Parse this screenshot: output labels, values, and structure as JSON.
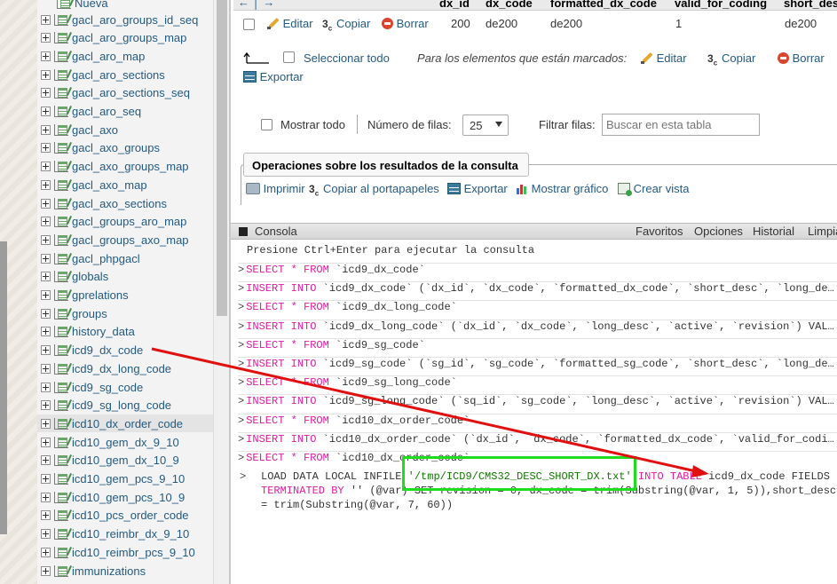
{
  "sidebar": {
    "top_partial": "Nueva",
    "items": [
      "gacl_aro_groups_id_seq",
      "gacl_aro_groups_map",
      "gacl_aro_map",
      "gacl_aro_sections",
      "gacl_aro_sections_seq",
      "gacl_aro_seq",
      "gacl_axo",
      "gacl_axo_groups",
      "gacl_axo_groups_map",
      "gacl_axo_map",
      "gacl_axo_sections",
      "gacl_groups_aro_map",
      "gacl_groups_axo_map",
      "gacl_phpgacl",
      "globals",
      "gprelations",
      "groups",
      "history_data",
      "icd9_dx_code",
      "icd9_dx_long_code",
      "icd9_sg_code",
      "icd9_sg_long_code",
      "icd10_dx_order_code",
      "icd10_gem_dx_9_10",
      "icd10_gem_dx_10_9",
      "icd10_gem_pcs_9_10",
      "icd10_gem_pcs_10_9",
      "icd10_pcs_order_code",
      "icd10_reimbr_dx_9_10",
      "icd10_reimbr_pcs_9_10",
      "immunizations"
    ],
    "active_item": "icd10_dx_order_code"
  },
  "results_table": {
    "nav_arrows": "← │ →",
    "columns": [
      "dx_id",
      "dx_code",
      "formatted_dx_code",
      "valid_for_coding",
      "short_desc"
    ],
    "row": {
      "edit": "Editar",
      "copy": "Copiar",
      "delete": "Borrar",
      "dx_id": "200",
      "dx_code": "de200",
      "formatted_dx_code": "de200",
      "valid_for_coding": "1",
      "short_desc": "de200"
    }
  },
  "bulk_actions": {
    "select_all": "Seleccionar todo",
    "for_marked": "Para los elementos que están marcados:",
    "edit": "Editar",
    "copy": "Copiar",
    "delete": "Borrar",
    "export": "Exportar"
  },
  "display_controls": {
    "show_all": "Mostrar todo",
    "rows_label": "Número de filas:",
    "rows_value": "25",
    "filter_label": "Filtrar filas:",
    "filter_placeholder": "Buscar en esta tabla"
  },
  "query_ops": {
    "legend": "Operaciones sobre los resultados de la consulta",
    "print": "Imprimir",
    "copy_clipboard": "Copiar al portapapeles",
    "export": "Exportar",
    "show_chart": "Mostrar gráfico",
    "create_view": "Crear vista"
  },
  "console": {
    "title": "Consola",
    "menu": [
      "Favoritos",
      "Opciones",
      "Historial",
      "Limpia"
    ],
    "hint": "Presione Ctrl+Enter para ejecutar la consulta",
    "queries": [
      {
        "k": "SELECT * FROM",
        "r": " `icd9_dx_code`"
      },
      {
        "k": "INSERT INTO",
        "r": " `icd9_dx_code` (`dx_id`, `dx_code`, `formatted_dx_code`, `short_desc`, `long_de…"
      },
      {
        "k": "SELECT * FROM",
        "r": " `icd9_dx_long_code`"
      },
      {
        "k": "INSERT INTO",
        "r": " `icd9_dx_long_code` (`dx_id`, `dx_code`, `long_desc`, `active`, `revision`) VAL…"
      },
      {
        "k": "SELECT * FROM",
        "r": " `icd9_sg_code`"
      },
      {
        "k": "INSERT INTO",
        "r": " `icd9_sg_code` (`sg_id`, `sg_code`, `formatted_sg_code`, `short_desc`, `long_de…"
      },
      {
        "k": "SELECT * FROM",
        "r": " `icd9_sg_long_code`"
      },
      {
        "k": "INSERT INTO",
        "r": " `icd9_sg_long_code` (`sq_id`, `sg_code`, `long_desc`, `active`, `revision`) VAL…"
      },
      {
        "k": "SELECT * FROM",
        "r": " `icd10_dx_order_code`"
      },
      {
        "k": "INSERT INTO",
        "r": " `icd10_dx_order_code` (`dx_id`, `dx_code`, `formatted_dx_code`, `valid_for_codi…"
      },
      {
        "k": "SELECT * FROM",
        "r": " `icd10_dx_order_code`"
      }
    ],
    "current": {
      "line1_a": "LOAD DATA LOCAL INFILE ",
      "line1_str": "'/tmp/ICD9/CMS32_DESC_SHORT_DX.txt'",
      "line1_kw": " INTO TABLE",
      "line1_b": " icd9_dx_code FIELDS",
      "line2_kw": "TERMINATED BY",
      "line2_a": " '' (@var) SET revision = 0, dx_code = trim(Substring(@var, 1, 5)),short_desc",
      "line3": "= trim(Substring(@var, 7, 60))"
    }
  },
  "colors": {
    "link": "#235a81",
    "keyword": "#e11ba3",
    "annotation_box": "#1edc1e",
    "annotation_arrow": "#e01010"
  }
}
